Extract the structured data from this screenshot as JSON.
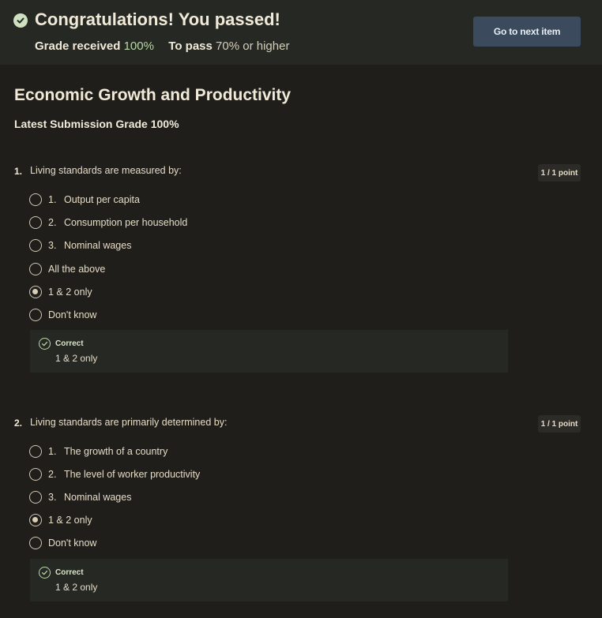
{
  "banner": {
    "title": "Congratulations! You passed!",
    "grade_received_label": "Grade received",
    "grade_received_value": "100%",
    "to_pass_label": "To pass",
    "to_pass_value": "70% or higher",
    "next_button": "Go to next item"
  },
  "quiz": {
    "title": "Economic Growth and Productivity",
    "latest_submission": "Latest Submission Grade 100%"
  },
  "questions": [
    {
      "number": "1.",
      "text": "Living standards are measured by:",
      "points": "1 / 1 point",
      "options": [
        {
          "num": "1.",
          "label": "Output per capita",
          "selected": false
        },
        {
          "num": "2.",
          "label": "Consumption per household",
          "selected": false
        },
        {
          "num": "3.",
          "label": "Nominal wages",
          "selected": false
        },
        {
          "num": "",
          "label": "All the above",
          "selected": false
        },
        {
          "num": "",
          "label": "1 & 2 only",
          "selected": true
        },
        {
          "num": "",
          "label": "Don't know",
          "selected": false
        }
      ],
      "feedback": {
        "status": "Correct",
        "answer": "1 & 2 only"
      }
    },
    {
      "number": "2.",
      "text": "Living standards are primarily determined by:",
      "points": "1 / 1 point",
      "options": [
        {
          "num": "1.",
          "label": "The growth of a country",
          "selected": false
        },
        {
          "num": "2.",
          "label": "The level of worker productivity",
          "selected": false
        },
        {
          "num": "3.",
          "label": "Nominal wages",
          "selected": false
        },
        {
          "num": "",
          "label": "1 & 2 only",
          "selected": true
        },
        {
          "num": "",
          "label": "Don't know",
          "selected": false
        }
      ],
      "feedback": {
        "status": "Correct",
        "answer": "1 & 2 only"
      }
    }
  ],
  "colors": {
    "background": "#1f1e1b",
    "banner": "#262824",
    "accent_green": "#b9d8a6",
    "button": "#3c4a5e"
  },
  "icons": {
    "banner": "check-circle-icon",
    "feedback": "check-circle-outline-icon"
  }
}
